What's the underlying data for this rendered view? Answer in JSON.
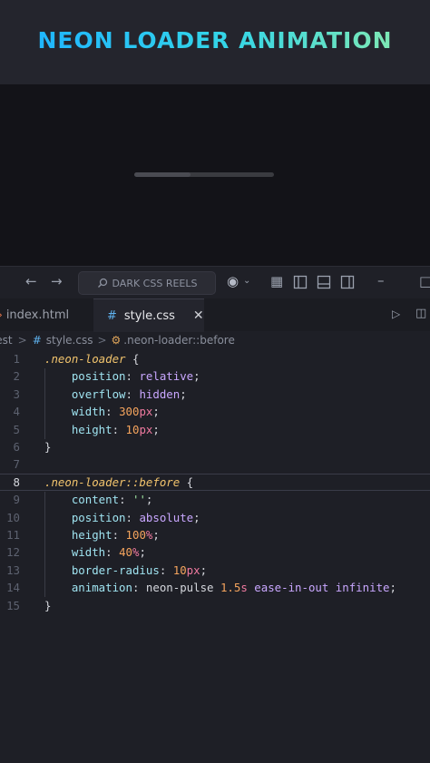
{
  "banner": {
    "title": "NEON LOADER ANIMATION"
  },
  "preview": {
    "loader_progress": 0.4
  },
  "toolbar": {
    "search_text": "DARK CSS REELS"
  },
  "tabs": [
    {
      "label": "index.html",
      "active": false
    },
    {
      "label": "style.css",
      "active": true
    }
  ],
  "breadcrumb": {
    "folder": "Test",
    "file": "style.css",
    "symbol": ".neon-loader::before",
    "separator": ">"
  },
  "editor": {
    "current_line": 8,
    "lines": [
      {
        "n": "1",
        "tokens": [
          {
            "t": ".neon-loader",
            "c": "sel"
          },
          {
            "t": " {",
            "c": "punc"
          }
        ]
      },
      {
        "n": "2",
        "tokens": [
          {
            "t": "    position",
            "c": "prop"
          },
          {
            "t": ": ",
            "c": "punc"
          },
          {
            "t": "relative",
            "c": "val"
          },
          {
            "t": ";",
            "c": "punc"
          }
        ]
      },
      {
        "n": "3",
        "tokens": [
          {
            "t": "    overflow",
            "c": "prop"
          },
          {
            "t": ": ",
            "c": "punc"
          },
          {
            "t": "hidden",
            "c": "val"
          },
          {
            "t": ";",
            "c": "punc"
          }
        ]
      },
      {
        "n": "4",
        "tokens": [
          {
            "t": "    width",
            "c": "prop"
          },
          {
            "t": ": ",
            "c": "punc"
          },
          {
            "t": "300",
            "c": "num"
          },
          {
            "t": "px",
            "c": "unit"
          },
          {
            "t": ";",
            "c": "punc"
          }
        ]
      },
      {
        "n": "5",
        "tokens": [
          {
            "t": "    height",
            "c": "prop"
          },
          {
            "t": ": ",
            "c": "punc"
          },
          {
            "t": "10",
            "c": "num"
          },
          {
            "t": "px",
            "c": "unit"
          },
          {
            "t": ";",
            "c": "punc"
          }
        ]
      },
      {
        "n": "6",
        "tokens": [
          {
            "t": "}",
            "c": "punc"
          }
        ]
      },
      {
        "n": "7",
        "tokens": []
      },
      {
        "n": "8",
        "tokens": [
          {
            "t": ".neon-loader::before",
            "c": "sel"
          },
          {
            "t": " {",
            "c": "punc"
          }
        ]
      },
      {
        "n": "9",
        "tokens": [
          {
            "t": "    content",
            "c": "prop"
          },
          {
            "t": ": ",
            "c": "punc"
          },
          {
            "t": "''",
            "c": "str"
          },
          {
            "t": ";",
            "c": "punc"
          }
        ]
      },
      {
        "n": "10",
        "tokens": [
          {
            "t": "    position",
            "c": "prop"
          },
          {
            "t": ": ",
            "c": "punc"
          },
          {
            "t": "absolute",
            "c": "val"
          },
          {
            "t": ";",
            "c": "punc"
          }
        ]
      },
      {
        "n": "11",
        "tokens": [
          {
            "t": "    height",
            "c": "prop"
          },
          {
            "t": ": ",
            "c": "punc"
          },
          {
            "t": "100",
            "c": "num"
          },
          {
            "t": "%",
            "c": "unit"
          },
          {
            "t": ";",
            "c": "punc"
          }
        ]
      },
      {
        "n": "12",
        "tokens": [
          {
            "t": "    width",
            "c": "prop"
          },
          {
            "t": ": ",
            "c": "punc"
          },
          {
            "t": "40",
            "c": "num"
          },
          {
            "t": "%",
            "c": "unit"
          },
          {
            "t": ";",
            "c": "punc"
          }
        ]
      },
      {
        "n": "13",
        "tokens": [
          {
            "t": "    border-radius",
            "c": "prop"
          },
          {
            "t": ": ",
            "c": "punc"
          },
          {
            "t": "10",
            "c": "num"
          },
          {
            "t": "px",
            "c": "unit"
          },
          {
            "t": ";",
            "c": "punc"
          }
        ]
      },
      {
        "n": "14",
        "tokens": [
          {
            "t": "    animation",
            "c": "prop"
          },
          {
            "t": ": ",
            "c": "punc"
          },
          {
            "t": "neon-pulse ",
            "c": "plain"
          },
          {
            "t": "1.5",
            "c": "num"
          },
          {
            "t": "s",
            "c": "unit"
          },
          {
            "t": " ease-in-out infinite",
            "c": "val"
          },
          {
            "t": ";",
            "c": "punc"
          }
        ]
      },
      {
        "n": "15",
        "tokens": [
          {
            "t": "}",
            "c": "punc"
          }
        ]
      }
    ]
  }
}
